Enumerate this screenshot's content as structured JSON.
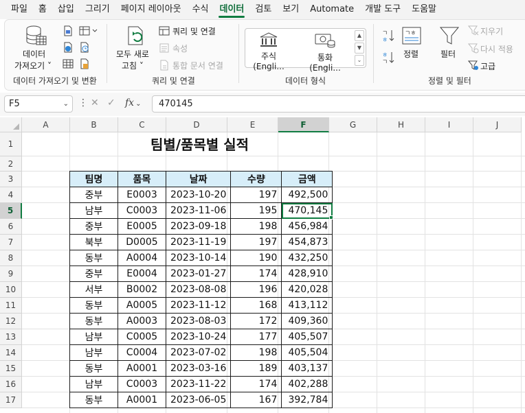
{
  "menu": {
    "tabs": [
      {
        "label": "파일"
      },
      {
        "label": "홈"
      },
      {
        "label": "삽입"
      },
      {
        "label": "그리기"
      },
      {
        "label": "페이지 레이아웃"
      },
      {
        "label": "수식"
      },
      {
        "label": "데이터",
        "active": true
      },
      {
        "label": "검토"
      },
      {
        "label": "보기"
      },
      {
        "label": "Automate"
      },
      {
        "label": "개발 도구"
      },
      {
        "label": "도움말"
      }
    ]
  },
  "ribbon": {
    "get_data": {
      "line1": "데이터",
      "line2": "가져오기 ˅",
      "group_label": "데이터 가져오기 및 변환"
    },
    "refresh": {
      "line1": "모두 새로",
      "line2": "고침 ˅",
      "queries": "쿼리 및 연결",
      "properties": "속성",
      "edit_links": "통합 문서 연결",
      "group_label": "쿼리 및 연결"
    },
    "data_types": {
      "stocks": "주식 (Engli...",
      "currency": "통화 (Engli...",
      "group_label": "데이터 형식"
    },
    "sort_filter": {
      "sort": "정렬",
      "filter": "필터",
      "clear": "지우기",
      "reapply": "다시 적용",
      "advanced": "고급",
      "group_label": "정렬 및 필터"
    }
  },
  "formula_bar": {
    "name_box": "F5",
    "formula": "470145",
    "fx": "fx"
  },
  "sheet": {
    "columns": [
      "A",
      "B",
      "C",
      "D",
      "E",
      "F",
      "G",
      "H",
      "I",
      "J"
    ],
    "selected_column": "F",
    "rows": [
      "1",
      "2",
      "3",
      "4",
      "5",
      "6",
      "7",
      "8",
      "9",
      "10",
      "11",
      "12",
      "13",
      "14",
      "15",
      "16",
      "17"
    ],
    "selected_row": "5",
    "title": "팀별/품목별 실적",
    "headers": [
      "팀명",
      "품목",
      "날짜",
      "수량",
      "금액"
    ],
    "data": [
      [
        "중부",
        "E0003",
        "2023-10-20",
        "197",
        "492,500"
      ],
      [
        "남부",
        "C0003",
        "2023-11-06",
        "195",
        "470,145"
      ],
      [
        "중부",
        "E0005",
        "2023-09-18",
        "198",
        "456,984"
      ],
      [
        "북부",
        "D0005",
        "2023-11-19",
        "197",
        "454,873"
      ],
      [
        "동부",
        "A0004",
        "2023-10-14",
        "190",
        "432,250"
      ],
      [
        "중부",
        "E0004",
        "2023-01-27",
        "174",
        "428,910"
      ],
      [
        "서부",
        "B0002",
        "2023-08-08",
        "196",
        "420,028"
      ],
      [
        "동부",
        "A0005",
        "2023-11-12",
        "168",
        "413,112"
      ],
      [
        "동부",
        "A0003",
        "2023-08-03",
        "172",
        "409,360"
      ],
      [
        "남부",
        "C0005",
        "2023-10-24",
        "177",
        "405,507"
      ],
      [
        "남부",
        "C0004",
        "2023-07-02",
        "198",
        "405,504"
      ],
      [
        "동부",
        "A0001",
        "2023-03-16",
        "189",
        "403,137"
      ],
      [
        "남부",
        "C0003",
        "2023-11-22",
        "174",
        "402,288"
      ],
      [
        "동부",
        "A0001",
        "2023-06-05",
        "167",
        "392,784"
      ]
    ]
  },
  "colors": {
    "accent": "#107c41",
    "header_fill": "#d7eef9"
  }
}
